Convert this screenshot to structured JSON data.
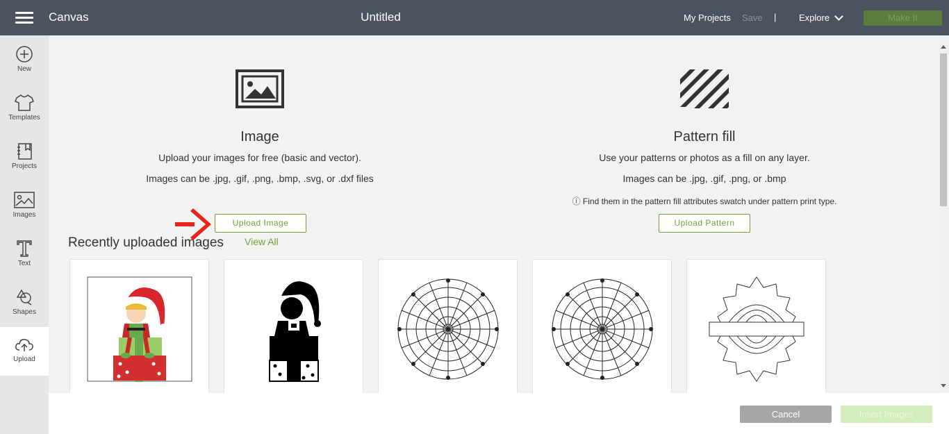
{
  "topbar": {
    "app_title": "Canvas",
    "doc_title": "Untitled",
    "my_projects": "My Projects",
    "save": "Save",
    "divider": "|",
    "explore": "Explore",
    "make_it": "Make It",
    "make_it_color": "#5a7c3e"
  },
  "sidebar": {
    "items": [
      {
        "label": "New",
        "icon": "plus-circle-icon"
      },
      {
        "label": "Templates",
        "icon": "tshirt-icon"
      },
      {
        "label": "Projects",
        "icon": "notebook-icon"
      },
      {
        "label": "Images",
        "icon": "image-icon"
      },
      {
        "label": "Text",
        "icon": "text-t-icon"
      },
      {
        "label": "Shapes",
        "icon": "shapes-icon"
      },
      {
        "label": "Upload",
        "icon": "cloud-upload-icon"
      }
    ],
    "active": "Upload"
  },
  "image_section": {
    "icon": "image-icon",
    "title": "Image",
    "description": "Upload your images for free (basic and vector).",
    "formats": "Images can be .jpg, .gif, .png, .bmp, .svg, or .dxf files",
    "button": "Upload Image"
  },
  "pattern_section": {
    "icon": "striped-pattern-icon",
    "title": "Pattern fill",
    "description": "Use your patterns or photos as a fill on any layer.",
    "formats": "Images can be .jpg, .gif, .png, or .bmp",
    "note": "ⓘ Find them in the pattern fill attributes swatch under pattern print type.",
    "button": "Upload Pattern"
  },
  "recent": {
    "title": "Recently uploaded images",
    "view_all": "View All",
    "thumbnails": [
      {
        "icon": "elf-on-gift-color-thumbnail"
      },
      {
        "icon": "elf-on-gift-silhouette-thumbnail"
      },
      {
        "icon": "floral-mandala-thumbnail"
      },
      {
        "icon": "floral-mandala-thumbnail"
      },
      {
        "icon": "split-mandala-thumbnail"
      }
    ]
  },
  "footer": {
    "cancel": "Cancel",
    "insert_images": "Insert Images"
  },
  "colors": {
    "accent": "#6ea33c",
    "topbar": "#4b545e",
    "annotation_arrow": "#e8231a"
  }
}
